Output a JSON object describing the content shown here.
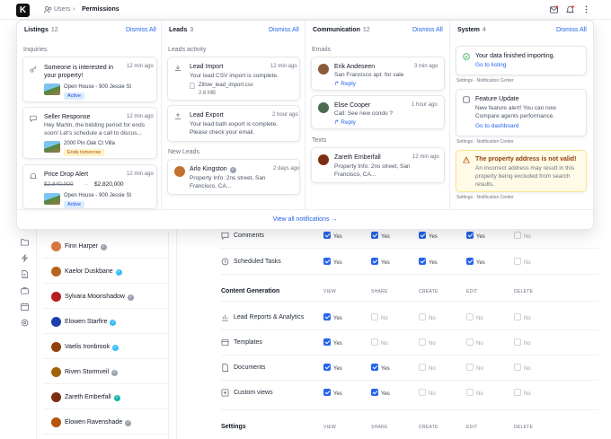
{
  "topbar": {
    "logo": "K",
    "breadcrumb_users": "Users",
    "breadcrumb_sep": "›",
    "breadcrumb_current": "Permissions"
  },
  "users": [
    {
      "name": "Finn Harper",
      "badge": "grey",
      "color": "#d97742"
    },
    {
      "name": "Kaelor Duskbane",
      "badge": "blue",
      "color": "#b5651d"
    },
    {
      "name": "Sylvara Moonshadow",
      "badge": "grey",
      "color": "#b91c1c"
    },
    {
      "name": "Elowen Starfire",
      "badge": "blue",
      "color": "#1e40af"
    },
    {
      "name": "Vaelis Ironbrook",
      "badge": "blue",
      "color": "#92400e"
    },
    {
      "name": "Riven Stormveil",
      "badge": "grey",
      "color": "#a16207"
    },
    {
      "name": "Zareth Emberfall",
      "badge": "teal",
      "color": "#7c2d12"
    },
    {
      "name": "Elowen Ravenshade",
      "badge": "grey",
      "color": "#b45309"
    }
  ],
  "permissions": {
    "yes": "Yes",
    "no": "No",
    "columns": [
      "VIEW",
      "SHARE",
      "CREATE",
      "EDIT",
      "DELETE"
    ],
    "top_rows": [
      {
        "label": "Comments",
        "icon": "comment-icon",
        "values": [
          true,
          true,
          true,
          true,
          false
        ]
      },
      {
        "label": "Scheduled Tasks",
        "icon": "tasks-icon",
        "values": [
          true,
          true,
          true,
          true,
          false
        ]
      }
    ],
    "section_content": "Content Generation",
    "content_rows": [
      {
        "label": "Lead Reports & Analytics",
        "icon": "chart-icon",
        "values": [
          true,
          false,
          false,
          false,
          false
        ]
      },
      {
        "label": "Templates",
        "icon": "template-icon",
        "values": [
          true,
          false,
          false,
          false,
          false
        ]
      },
      {
        "label": "Documents",
        "icon": "document-icon",
        "values": [
          true,
          true,
          false,
          false,
          false
        ]
      },
      {
        "label": "Custom views",
        "icon": "custom-view-icon",
        "values": [
          true,
          true,
          false,
          false,
          false
        ]
      }
    ],
    "section_settings": "Settings"
  },
  "notifications": {
    "dismiss_label": "Dismiss All",
    "footer_link": "View all notifications →",
    "listings": {
      "title": "Listings",
      "count": "12",
      "sub": "Inquiries",
      "cards": [
        {
          "title": "Someone is interested in your property!",
          "time": "12 min ago",
          "property": "Open House - 900 Jessie St",
          "chip": "Active"
        },
        {
          "title": "Seller Response",
          "time": "12 min ago",
          "body": "Hey Martin, the bidding period for ends soon! Let's schedule a call to discus...",
          "property": "2000 Pin Oak Ct Villa",
          "chip": "Ends tomorrow"
        },
        {
          "title": "Price Drop Alert",
          "time": "12 min ago",
          "old_price": "$2,840,000",
          "arrow": "→",
          "new_price": "$2,820,000",
          "property": "Open House - 900 Jessie St",
          "chip": "Active"
        }
      ]
    },
    "leads": {
      "title": "Leads",
      "count": "3",
      "sub_activity": "Leads activity",
      "sub_new": "New Leads",
      "cards": [
        {
          "title": "Lead Import",
          "time": "12 min ago",
          "body": "Your lead CSV import is complete.",
          "file": "Zillow_lead_import.csv",
          "size": "2.6 MB"
        },
        {
          "title": "Lead Export",
          "time": "2 hour ago",
          "body": "Your lead bath export is complete. Please check your email."
        },
        {
          "title": "Arlo Kingston",
          "time": "2 days ago",
          "body": "Property Info: 2ns street, San Francisco, CA..."
        }
      ]
    },
    "communication": {
      "title": "Communication",
      "count": "12",
      "sub_emails": "Emails",
      "sub_texts": "Texts",
      "reply": "Reply",
      "cards": [
        {
          "title": "Erik Andeseen",
          "time": "3 min ago",
          "body": "Re: 900 Jessie St",
          "body2": "San Francisco apt. for sale"
        },
        {
          "title": "Elise Cooper",
          "time": "1 hour ago",
          "body": "Call: See new condo ?"
        },
        {
          "title": "Zareth Emberfall",
          "time": "12 min ago",
          "body": "Property Info: 2ns street, San Francisco, CA..."
        }
      ]
    },
    "system": {
      "title": "System",
      "count": "4",
      "cards": [
        {
          "title": "Your data finished importing.",
          "link": "Go to listing",
          "meta": "Settings · Notification Center"
        },
        {
          "title": "Feature Update",
          "body": "New feature alert! You can now Compare agents performance.",
          "link": "Go to dashboard",
          "meta": "Settings · Notification Center"
        },
        {
          "title": "The property address is not valid!",
          "body": "An incorrect address may result in this property being excluded from search results.",
          "meta": "Settings · Notification Center"
        }
      ]
    }
  },
  "colors": {
    "accent": "#2563eb",
    "warning_bg": "#fffbe6",
    "warning_border": "#fde68a"
  }
}
